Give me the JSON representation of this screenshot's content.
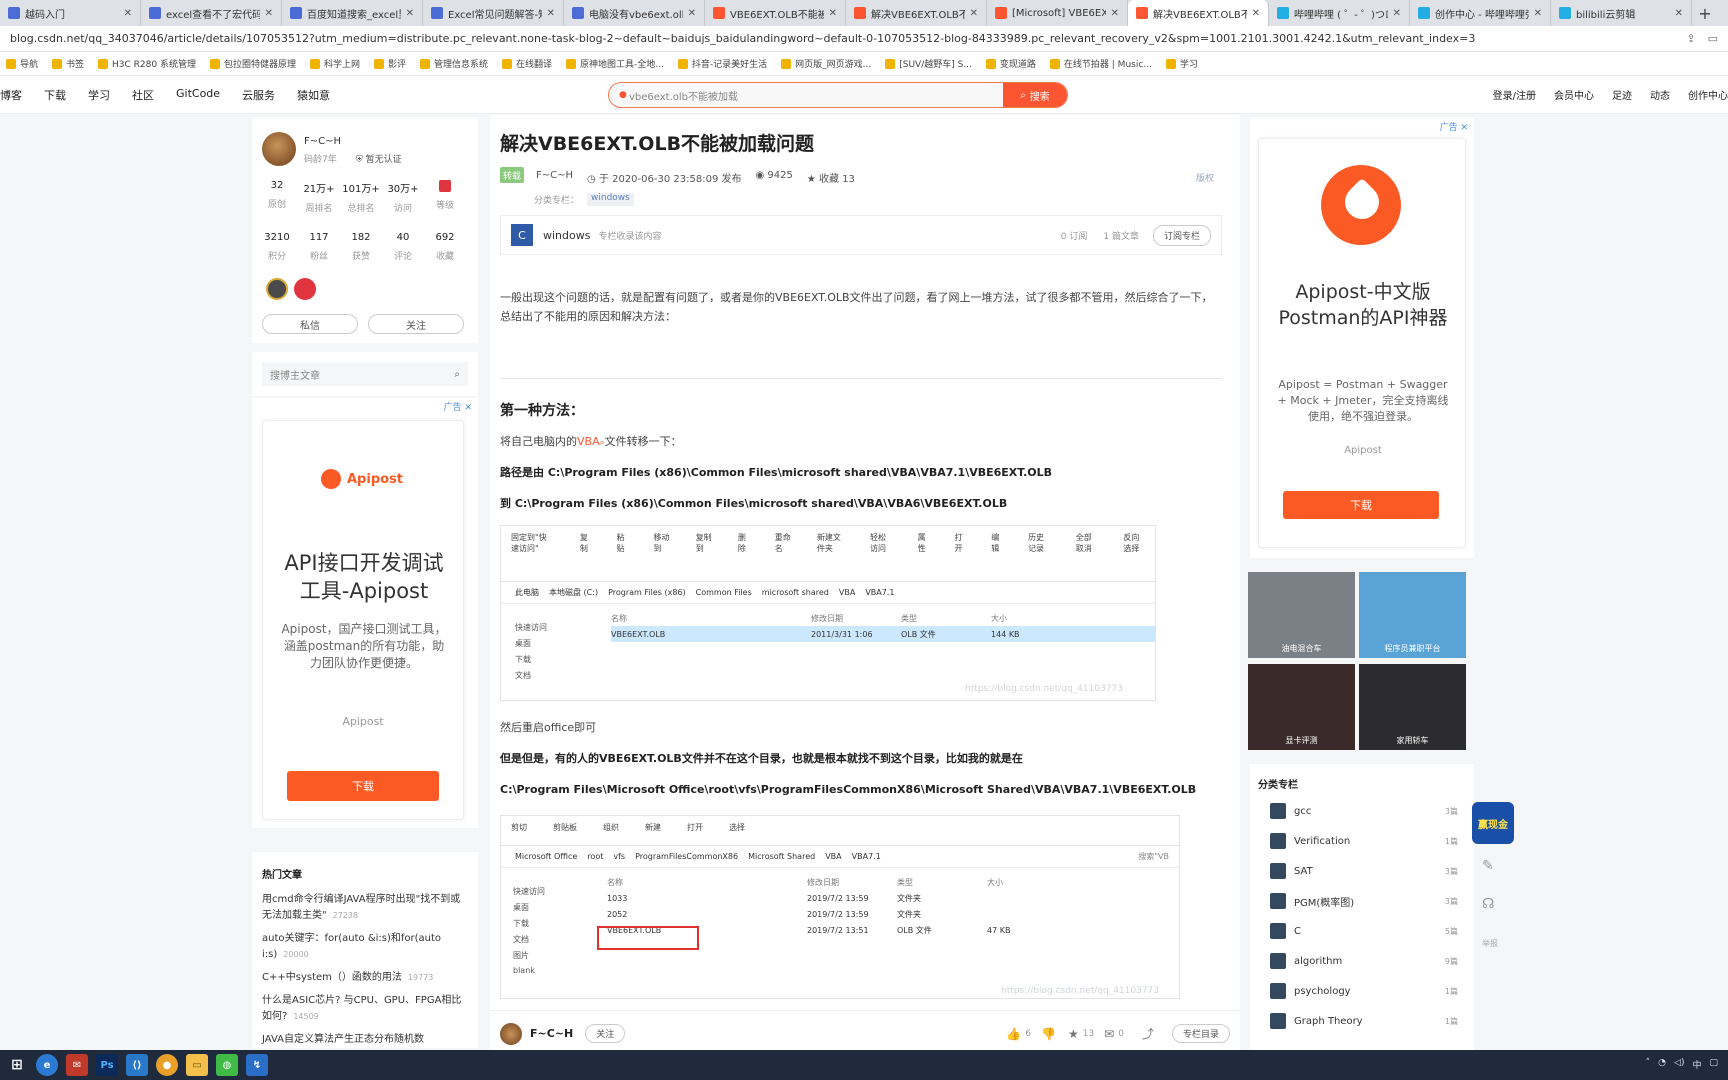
{
  "browser": {
    "tabs": [
      {
        "label": "越码入门",
        "color": "#4b6bd6"
      },
      {
        "label": "excel查看不了宏代码",
        "color": "#4b6bd6"
      },
      {
        "label": "百度知道搜索_excel里",
        "color": "#4b6bd6"
      },
      {
        "label": "Excel常见问题解答-知",
        "color": "#4b6bd6"
      },
      {
        "label": "电脑没有vbe6ext.olb",
        "color": "#4b6bd6"
      },
      {
        "label": "VBE6EXT.OLB不能被加",
        "color": "#fc5531"
      },
      {
        "label": "解决VBE6EXT.OLB不能",
        "color": "#fc5531"
      },
      {
        "label": "[Microsoft] VBE6EX",
        "color": "#fc5531"
      },
      {
        "label": "解决VBE6EXT.OLB不能",
        "color": "#fc5531",
        "active": true
      },
      {
        "label": "哔哩哔哩 ( ゜- ゜)つロ",
        "color": "#23ade5"
      },
      {
        "label": "创作中心 - 哔哩哔哩弹",
        "color": "#23ade5"
      },
      {
        "label": "bilibili云剪辑",
        "color": "#23ade5"
      }
    ],
    "new_tab": "+",
    "url": "blog.csdn.net/qq_34037046/article/details/107053512?utm_medium=distribute.pc_relevant.none-task-blog-2~default~baidujs_baidulandingword~default-0-107053512-blog-84333989.pc_relevant_recovery_v2&spm=1001.2101.3001.4242.1&utm_relevant_index=3",
    "bookmarks": [
      "导航",
      "书签",
      "H3C R280 系统管理",
      "包拉圈特健器原理",
      "科学上网",
      "影评",
      "管理信息系统",
      "在线翻译",
      "原神地图工具-全地...",
      "抖音-记录美好生活",
      "网页版_网页游戏...",
      "[SUV/越野车] S...",
      "变现道路",
      "在线节拍器 | Music...",
      "学习"
    ]
  },
  "site": {
    "nav": [
      "博客",
      "下载",
      "学习",
      "社区",
      "GitCode",
      "云服务",
      "猿如意"
    ],
    "search_placeholder": "vbe6ext.olb不能被加载",
    "search_button": "搜索",
    "nav_right": [
      "登录/注册",
      "会员中心",
      "足迹",
      "动态",
      "创作中心"
    ]
  },
  "author": {
    "name": "F~C~H",
    "years": "码龄7年",
    "verify": "暂无认证",
    "stats1": [
      {
        "value": "32",
        "label": "原创"
      },
      {
        "value": "21万+",
        "label": "周排名"
      },
      {
        "value": "101万+",
        "label": "总排名"
      },
      {
        "value": "30万+",
        "label": "访问"
      },
      {
        "value": "",
        "label": "等级"
      }
    ],
    "stats2": [
      {
        "value": "3210",
        "label": "积分"
      },
      {
        "value": "117",
        "label": "粉丝"
      },
      {
        "value": "182",
        "label": "获赞"
      },
      {
        "value": "40",
        "label": "评论"
      },
      {
        "value": "692",
        "label": "收藏"
      }
    ],
    "private_msg": "私信",
    "follow": "关注",
    "search_placeholder": "搜博主文章"
  },
  "left_ad": {
    "tag": "广告",
    "brand": "Apipost",
    "headline": "API接口开发调试工具-Apipost",
    "desc": "Apipost，国产接口测试工具，涵盖postman的所有功能，助力团队协作更便捷。",
    "source": "Apipost",
    "button": "下载"
  },
  "hot": {
    "title": "热门文章",
    "items": [
      {
        "text": "用cmd命令行编译JAVA程序时出现\"找不到或无法加载主类\"",
        "views": "27238"
      },
      {
        "text": "auto关键字：for(auto &i:s)和for(auto i:s)",
        "views": "20000"
      },
      {
        "text": "C++中system（）函数的用法",
        "views": "19773"
      },
      {
        "text": "什么是ASIC芯片? 与CPU、GPU、FPGA相比如何?",
        "views": "14509"
      },
      {
        "text": "JAVA自定义算法产生正态分布随机数",
        "views": ""
      }
    ]
  },
  "article": {
    "title": "解决VBE6EXT.OLB不能被加载问题",
    "badge": "转载",
    "author": "F~C~H",
    "date": "于 2020-06-30 23:58:09 发布",
    "views": "9425",
    "favorites": "收藏 13",
    "copyright": "版权",
    "column_label": "分类专栏：",
    "column_tag": "windows",
    "column_name": "windows",
    "column_desc": "专栏收录该内容",
    "column_subs": "0 订阅",
    "column_count": "1 篇文章",
    "column_button": "订阅专栏",
    "intro": "一般出现这个问题的话，就是配置有问题了，或者是你的VBE6EXT.OLB文件出了问题，看了网上一堆方法，试了很多都不管用，然后综合了一下，总结出了不能用的原因和解决方法：",
    "section1": "第一种方法：",
    "move_prefix": "将自己电脑内的",
    "move_link": "VBA",
    "move_suffix": "文件转移一下：",
    "path_from": "路径是由 C:\\Program Files (x86)\\Common Files\\microsoft shared\\VBA\\VBA7.1\\VBE6EXT.OLB",
    "path_to": "到 C:\\Program Files (x86)\\Common Files\\microsoft shared\\VBA\\VBA6\\VBE6EXT.OLB",
    "restart": "然后重启office即可",
    "but": "但是但是，有的人的VBE6EXT.OLB文件并不在这个目录，也就是根本就找不到这个目录，比如我的就是在",
    "path_other": "C:\\Program Files\\Microsoft Office\\root\\vfs\\ProgramFilesCommonX86\\Microsoft Shared\\VBA\\VBA7.1\\VBE6EXT.OLB",
    "watermark1": "https://blog.csdn.net/qq_41103773",
    "watermark2": "https://blog.csdn.net/qq_41103773"
  },
  "shot1": {
    "ribbon": [
      "固定到\"快速访问\"",
      "复制",
      "粘贴",
      "移动到",
      "复制到",
      "删除",
      "重命名",
      "新建文件夹",
      "轻松访问",
      "属性",
      "打开",
      "编辑",
      "历史记录",
      "全部取消",
      "反向选择"
    ],
    "groups": [
      "剪贴板",
      "组织",
      "新建",
      "打开",
      "选择"
    ],
    "crumbs": [
      "此电脑",
      "本地磁盘 (C:)",
      "Program Files (x86)",
      "Common Files",
      "microsoft shared",
      "VBA",
      "VBA7.1"
    ],
    "headers": [
      "名称",
      "修改日期",
      "类型",
      "大小"
    ],
    "nav": [
      "快速访问",
      "桌面",
      "下载",
      "文档"
    ],
    "file": {
      "name": "VBE6EXT.OLB",
      "date": "2011/3/31 1:06",
      "type": "OLB 文件",
      "size": "144 KB"
    }
  },
  "shot2": {
    "ribbon": [
      "剪切",
      "剪贴板",
      "组织",
      "新建",
      "打开",
      "选择"
    ],
    "crumbs": [
      "Microsoft Office",
      "root",
      "vfs",
      "ProgramFilesCommonX86",
      "Microsoft Shared",
      "VBA",
      "VBA7.1"
    ],
    "search": "搜索\"VB",
    "headers": [
      "名称",
      "修改日期",
      "类型",
      "大小"
    ],
    "nav": [
      "快速访问",
      "桌面",
      "下载",
      "文档",
      "图片",
      "blank"
    ],
    "rows": [
      {
        "name": "1033",
        "date": "2019/7/2 13:59",
        "type": "文件夹",
        "size": ""
      },
      {
        "name": "2052",
        "date": "2019/7/2 13:59",
        "type": "文件夹",
        "size": ""
      },
      {
        "name": "VBE6EXT.OLB",
        "date": "2019/7/2 13:51",
        "type": "OLB 文件",
        "size": "47 KB"
      }
    ]
  },
  "bottom_bar": {
    "author": "F~C~H",
    "follow": "关注",
    "likes": "6",
    "favorites": "13",
    "comments": "0",
    "column": "专栏目录"
  },
  "right_ad": {
    "tag": "广告",
    "headline": "Apipost-中文版Postman的API神器",
    "desc": "Apipost = Postman + Swagger + Mock + Jmeter，完全支持离线使用，绝不强迫登录。",
    "source": "Apipost",
    "button": "下载"
  },
  "image_ads": [
    {
      "label": "油电混合车",
      "bg": "#7b7f86"
    },
    {
      "label": "程序员兼职平台",
      "bg": "#5aa3d6"
    },
    {
      "label": "显卡评测",
      "bg": "#3a2a2a"
    },
    {
      "label": "家用轿车",
      "bg": "#2c2c2e"
    }
  ],
  "categories": {
    "title": "分类专栏",
    "items": [
      {
        "name": "gcc",
        "count": "3篇"
      },
      {
        "name": "Verification",
        "count": "1篇"
      },
      {
        "name": "SAT",
        "count": "3篇"
      },
      {
        "name": "PGM(概率图)",
        "count": "3篇"
      },
      {
        "name": "C",
        "count": "5篇"
      },
      {
        "name": "algorithm",
        "count": "9篇"
      },
      {
        "name": "psychology",
        "count": "1篇"
      },
      {
        "name": "Graph Theory",
        "count": "1篇"
      }
    ]
  },
  "floating": {
    "badge": "赢现金",
    "feedback": "举报"
  },
  "taskbar": {
    "tray": "中"
  },
  "colors": {
    "brand": "#fc5531",
    "ad_orange": "#fc5a25",
    "link_red": "#fc5531"
  }
}
